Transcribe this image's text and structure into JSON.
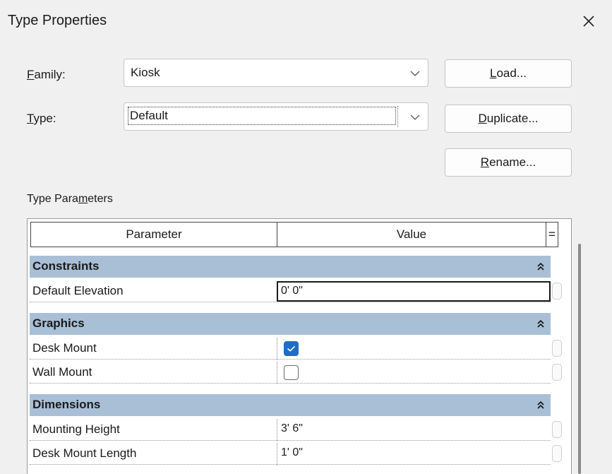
{
  "window": {
    "title": "Type Properties",
    "close_glyph": "×"
  },
  "family": {
    "label_prefix": "F",
    "label_rest": "amily:",
    "value": "Kiosk"
  },
  "type": {
    "label_prefix": "T",
    "label_rest": "ype:",
    "value": "Default"
  },
  "buttons": {
    "load": {
      "u": "L",
      "rest": "oad..."
    },
    "duplicate": {
      "u": "D",
      "rest": "uplicate..."
    },
    "rename": {
      "u": "R",
      "rest": "ename..."
    }
  },
  "section": {
    "pre": "Type Para",
    "u": "m",
    "post": "eters"
  },
  "table": {
    "col_parameter": "Parameter",
    "col_value": "Value",
    "col_extra": "=",
    "groups": [
      {
        "name": "Constraints",
        "rows": [
          {
            "name": "Default Elevation",
            "value": "0'  0\"",
            "editing": true
          }
        ]
      },
      {
        "name": "Graphics",
        "rows": [
          {
            "name": "Desk Mount",
            "checked": true
          },
          {
            "name": "Wall Mount",
            "checked": false
          }
        ]
      },
      {
        "name": "Dimensions",
        "rows": [
          {
            "name": "Mounting Height",
            "value": "3'  6\""
          },
          {
            "name": "Desk Mount Length",
            "value": "1'  0\""
          }
        ]
      }
    ]
  },
  "colors": {
    "group_header": "#a8bfd6",
    "checkbox_accent": "#1f6dc6",
    "dialog_bg": "#f0f0f0"
  }
}
